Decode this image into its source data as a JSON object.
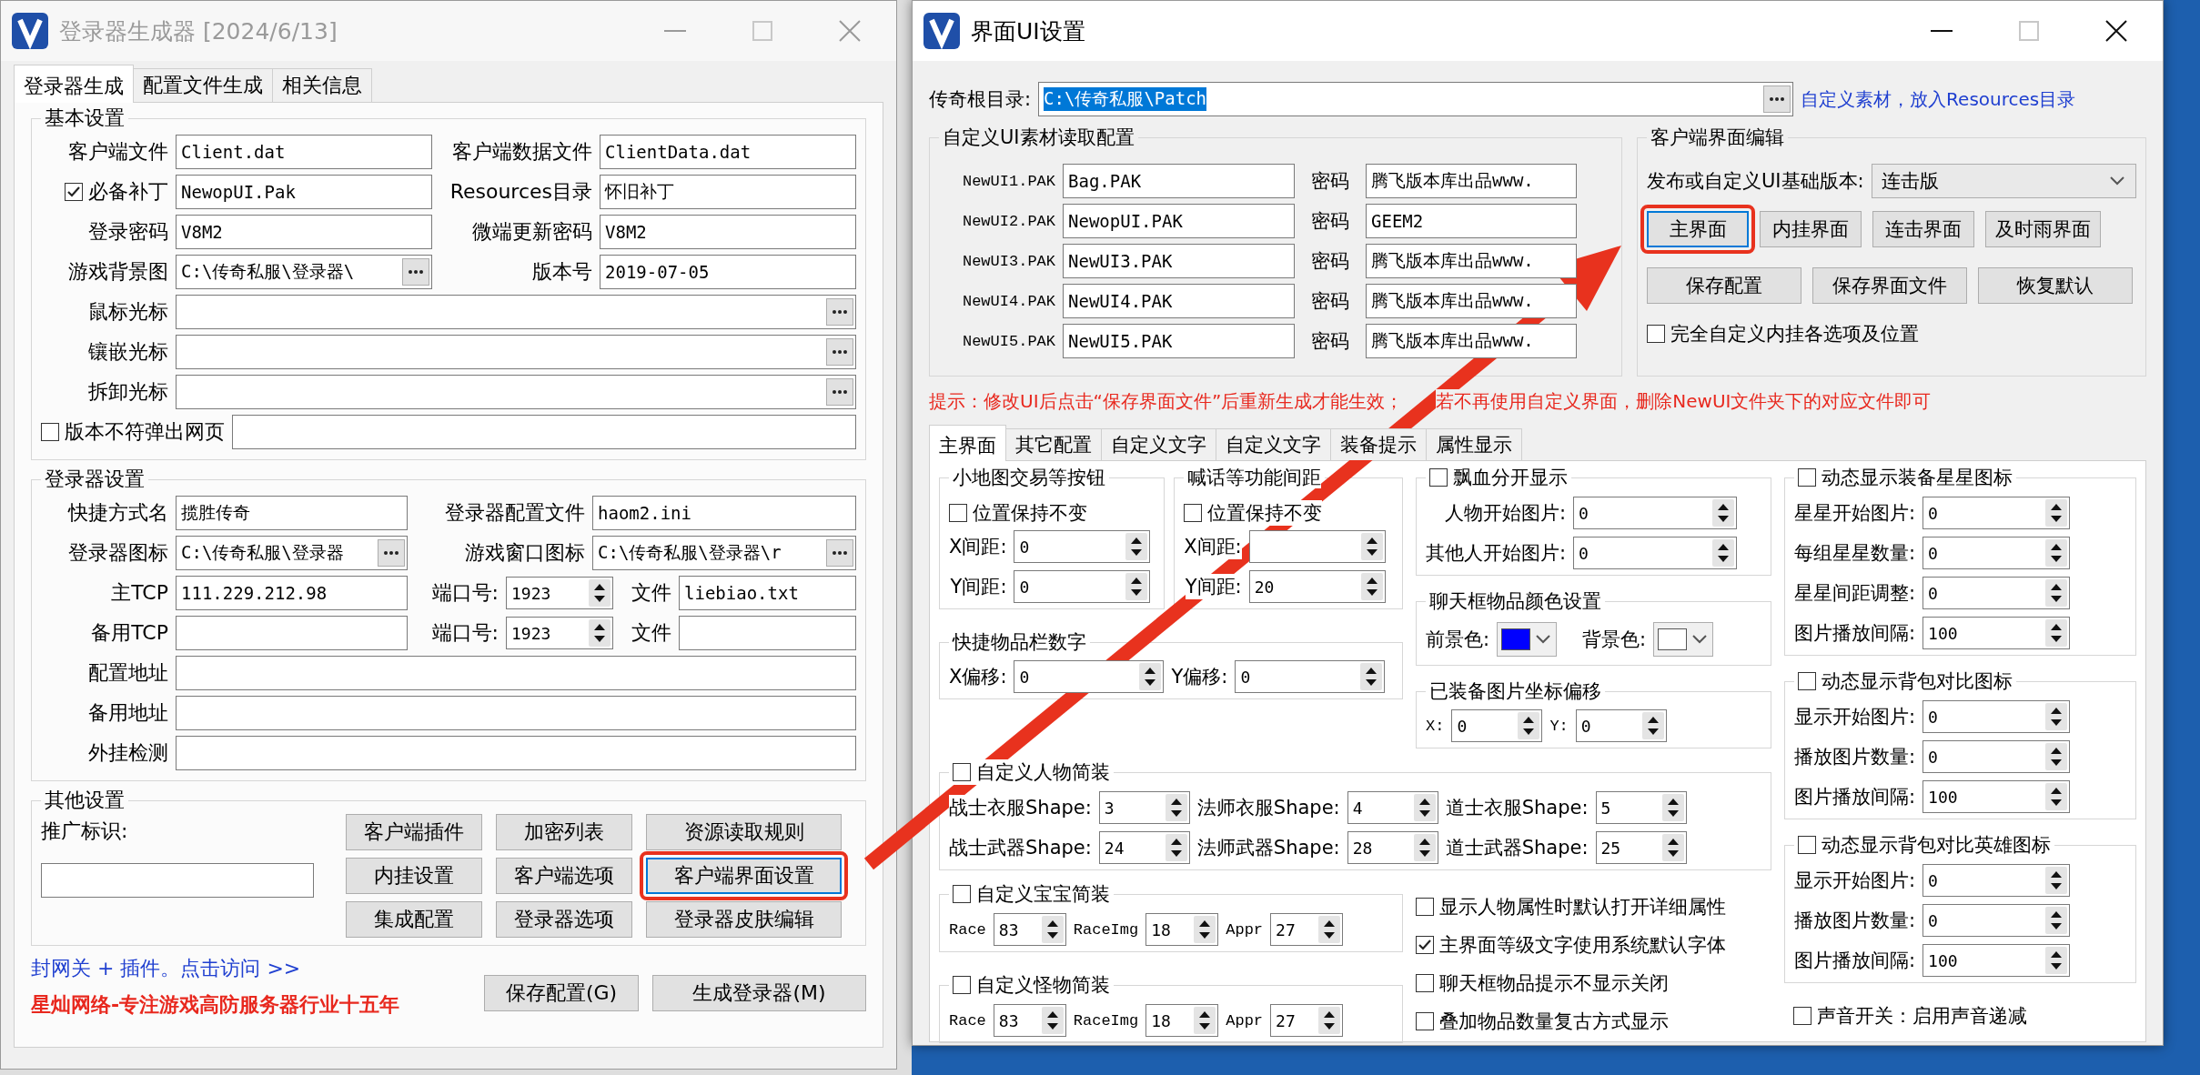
{
  "login_window": {
    "title": "登录器生成器 [2024/6/13]",
    "tabs": [
      {
        "label": "登录器生成",
        "selected": true
      },
      {
        "label": "配置文件生成",
        "selected": false
      },
      {
        "label": "相关信息",
        "selected": false
      }
    ],
    "basic": {
      "title": "基本设置",
      "pairs": [
        {
          "left": {
            "kind": "text",
            "label": "客户端文件",
            "value": "Client.dat",
            "browse": false
          },
          "right": {
            "kind": "text",
            "label": "客户端数据文件",
            "value": "ClientData.dat",
            "browse": false
          }
        },
        {
          "left": {
            "kind": "check",
            "label": "必备补丁",
            "checked": true,
            "value": "NewopUI.Pak",
            "browse": false
          },
          "right": {
            "kind": "text",
            "label": "Resources目录",
            "value": "怀旧补丁",
            "browse": false
          }
        },
        {
          "left": {
            "kind": "text",
            "label": "登录密码",
            "value": "V8M2",
            "browse": false
          },
          "right": {
            "kind": "text",
            "label": "微端更新密码",
            "value": "V8M2",
            "browse": false
          }
        },
        {
          "left": {
            "kind": "text",
            "label": "游戏背景图",
            "value": "C:\\传奇私服\\登录器\\",
            "browse": true
          },
          "right": {
            "kind": "text",
            "label": "版本号",
            "value": "2019-07-05",
            "browse": false
          }
        }
      ],
      "wide": [
        {
          "label": "鼠标光标",
          "browse": true
        },
        {
          "label": "镶嵌光标",
          "browse": true
        },
        {
          "label": "拆卸光标",
          "browse": true
        }
      ],
      "popup": {
        "label": "版本不符弹出网页",
        "checked": false
      }
    },
    "launcher": {
      "title": "登录器设置",
      "pairs": [
        {
          "left": {
            "kind": "text",
            "label": "快捷方式名",
            "value": "揽胜传奇",
            "browse": false
          },
          "right": {
            "kind": "text",
            "label": "登录器配置文件",
            "value": "haom2.ini",
            "browse": false
          }
        },
        {
          "left": {
            "kind": "text",
            "label": "登录器图标",
            "value": "C:\\传奇私服\\登录器",
            "browse": true
          },
          "right": {
            "kind": "text",
            "label": "游戏窗口图标",
            "value": "C:\\传奇私服\\登录器\\r",
            "browse": true
          }
        }
      ],
      "servers": [
        {
          "label": "主TCP",
          "value": "111.229.212.98",
          "port_label": "端口号:",
          "port": "1923",
          "file_label": "文件",
          "file": "liebiao.txt"
        },
        {
          "label": "备用TCP",
          "port_label": "端口号:",
          "port": "1923",
          "file_label": "文件"
        }
      ],
      "wide": [
        {
          "label": "配置地址"
        },
        {
          "label": "备用地址"
        },
        {
          "label": "外挂检测"
        }
      ]
    },
    "other": {
      "title": "其他设置",
      "promo_label": "推广标识:",
      "buttons": [
        {
          "label": "客户端插件",
          "annotated": false
        },
        {
          "label": "加密列表",
          "annotated": false
        },
        {
          "label": "资源读取规则",
          "annotated": false
        },
        {
          "label": "内挂设置",
          "annotated": false
        },
        {
          "label": "客户端选项",
          "annotated": false
        },
        {
          "label": "客户端界面设置",
          "annotated": true
        },
        {
          "label": "集成配置",
          "annotated": false
        },
        {
          "label": "登录器选项",
          "annotated": false
        },
        {
          "label": "登录器皮肤编辑",
          "annotated": false
        }
      ]
    },
    "link": "封网关 + 插件。点击访问 >>",
    "slogan": "星灿网络-专注游戏高防服务器行业十五年",
    "actions": [
      "保存配置(G)",
      "生成登录器(M)"
    ]
  },
  "ui_window": {
    "title": "界面UI设置",
    "root": {
      "label": "传奇根目录:",
      "value": "C:\\传奇私服\\Patch",
      "selected": true
    },
    "root_note": "自定义素材，放入Resources目录",
    "pak_group": {
      "title": "自定义UI素材读取配置",
      "rows": [
        {
          "label": "NewUI1.PAK",
          "file": "Bag.PAK",
          "pw_label": "密码",
          "password": "腾飞版本库出品www."
        },
        {
          "label": "NewUI2.PAK",
          "file": "NewopUI.PAK",
          "pw_label": "密码",
          "password": "GEEM2"
        },
        {
          "label": "NewUI3.PAK",
          "file": "NewUI3.PAK",
          "pw_label": "密码",
          "password": "腾飞版本库出品www."
        },
        {
          "label": "NewUI4.PAK",
          "file": "NewUI4.PAK",
          "pw_label": "密码",
          "password": "腾飞版本库出品www."
        },
        {
          "label": "NewUI5.PAK",
          "file": "NewUI5.PAK",
          "pw_label": "密码",
          "password": "腾飞版本库出品www."
        }
      ]
    },
    "editor": {
      "title": "客户端界面编辑",
      "version_label": "发布或自定义UI基础版本:",
      "version": "连击版",
      "button_rows": [
        [
          {
            "label": "主界面",
            "annotated": true
          },
          {
            "label": "内挂界面",
            "annotated": false
          },
          {
            "label": "连击界面",
            "annotated": false
          },
          {
            "label": "及时雨界面",
            "annotated": false
          }
        ],
        [
          {
            "label": "保存配置",
            "annotated": false
          },
          {
            "label": "保存界面文件",
            "annotated": false
          },
          {
            "label": "恢复默认",
            "annotated": false
          }
        ]
      ],
      "full_custom": {
        "label": "完全自定义内挂各选项及位置",
        "checked": false
      }
    },
    "hints": [
      "提示：修改UI后点击“保存界面文件”后重新生成才能生效；",
      "若不再使用自定义界面，删除NewUI文件夹下的对应文件即可"
    ],
    "tabs": [
      {
        "label": "主界面",
        "selected": true
      },
      {
        "label": "其它配置",
        "selected": false
      },
      {
        "label": "自定义文字",
        "selected": false
      },
      {
        "label": "自定义文字",
        "selected": false
      },
      {
        "label": "装备提示",
        "selected": false
      },
      {
        "label": "属性显示",
        "selected": false
      }
    ],
    "panel": {
      "minimap": {
        "title": "小地图交易等按钮",
        "lock": {
          "label": "位置保持不变",
          "checked": false
        },
        "spins": [
          {
            "label": "X间距:",
            "value": "0"
          },
          {
            "label": "Y间距:",
            "value": "0"
          }
        ]
      },
      "shout": {
        "title": "喊话等功能间距",
        "lock": {
          "label": "位置保持不变",
          "checked": false
        },
        "spins": [
          {
            "label": "X间距:"
          },
          {
            "label": "Y间距:",
            "value": "20"
          }
        ]
      },
      "quickbar": {
        "title": "快捷物品栏数字",
        "spins": [
          {
            "label": "X偏移:",
            "value": "0"
          },
          {
            "label": "Y偏移:",
            "value": "0"
          }
        ]
      },
      "blood": {
        "toggle": {
          "label": "飘血分开显示",
          "checked": false
        },
        "spins": [
          {
            "label": "人物开始图片:",
            "value": "0"
          },
          {
            "label": "其他人开始图片:",
            "value": "0"
          }
        ]
      },
      "chat_color": {
        "title": "聊天框物品颜色设置",
        "pickers": [
          {
            "label": "前景色:",
            "color": "#0000ff"
          },
          {
            "label": "背景色:",
            "color": "#ffffff"
          }
        ]
      },
      "equip_offset": {
        "title": "已装备图片坐标偏移",
        "spins": [
          {
            "label": "X:",
            "value": "0"
          },
          {
            "label": "Y:",
            "value": "0"
          }
        ]
      },
      "char_outfit": {
        "toggle": {
          "label": "自定义人物简装",
          "checked": false
        },
        "spins": [
          {
            "label": "战士衣服Shape:",
            "value": "3"
          },
          {
            "label": "法师衣服Shape:",
            "value": "4"
          },
          {
            "label": "道士衣服Shape:",
            "value": "5"
          },
          {
            "label": "战士武器Shape:",
            "value": "24"
          },
          {
            "label": "法师武器Shape:",
            "value": "28"
          },
          {
            "label": "道士武器Shape:",
            "value": "25"
          }
        ]
      },
      "pet_outfit": {
        "toggle": {
          "label": "自定义宝宝简装",
          "checked": false
        },
        "spins": [
          {
            "label": "Race",
            "value": "83"
          },
          {
            "label": "RaceImg",
            "value": "18"
          },
          {
            "label": "Appr",
            "value": "27"
          }
        ]
      },
      "monster_outfit": {
        "toggle": {
          "label": "自定义怪物简装",
          "checked": false
        },
        "spins": [
          {
            "label": "Race",
            "value": "83"
          },
          {
            "label": "RaceImg",
            "value": "18"
          },
          {
            "label": "Appr",
            "value": "27"
          }
        ]
      },
      "options": [
        {
          "label": "显示人物属性时默认打开详细属性",
          "checked": false
        },
        {
          "label": "主界面等级文字使用系统默认字体",
          "checked": true
        },
        {
          "label": "聊天框物品提示不显示关闭",
          "checked": false
        },
        {
          "label": "叠加物品数量复古方式显示",
          "checked": false
        }
      ],
      "star_icons": {
        "toggle": {
          "label": "动态显示装备星星图标",
          "checked": false
        },
        "spins": [
          {
            "label": "星星开始图片:",
            "value": "0"
          },
          {
            "label": "每组星星数量:",
            "value": "0"
          },
          {
            "label": "星星间距调整:",
            "value": "0"
          },
          {
            "label": "图片播放间隔:",
            "value": "100"
          }
        ]
      },
      "bag_compare": {
        "toggle": {
          "label": "动态显示背包对比图标",
          "checked": false
        },
        "spins": [
          {
            "label": "显示开始图片:",
            "value": "0"
          },
          {
            "label": "播放图片数量:",
            "value": "0"
          },
          {
            "label": "图片播放间隔:",
            "value": "100"
          }
        ]
      },
      "hero_compare": {
        "toggle": {
          "label": "动态显示背包对比英雄图标",
          "checked": false
        },
        "spins": [
          {
            "label": "显示开始图片:",
            "value": "0"
          },
          {
            "label": "播放图片数量:",
            "value": "0"
          },
          {
            "label": "图片播放间隔:",
            "value": "100"
          }
        ]
      },
      "sound": {
        "label": "声音开关：启用声音递减",
        "checked": false
      }
    }
  }
}
